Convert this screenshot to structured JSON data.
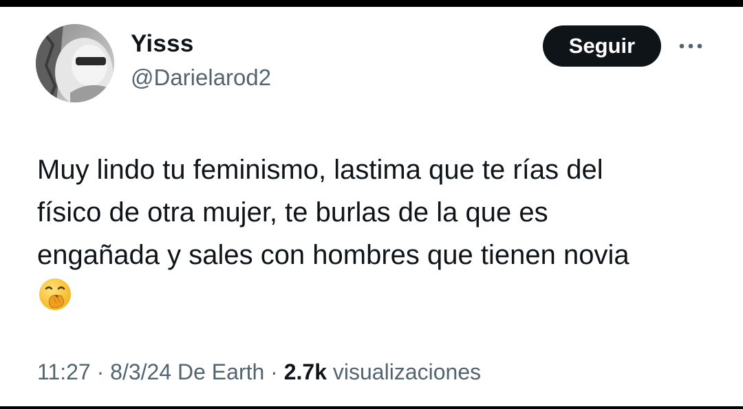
{
  "user": {
    "display_name": "Yisss",
    "handle": "@Darielarod2"
  },
  "actions": {
    "follow_label": "Seguir",
    "more_icon": "ellipsis-icon"
  },
  "tweet": {
    "lines": [
      "Muy lindo tu feminismo, lastima que te rías del",
      "físico de otra mujer, te burlas de la que es",
      "engañada y sales con hombres que tienen novia"
    ],
    "emoji": "yawning-face-emoji"
  },
  "meta": {
    "time": "11:27",
    "separator": "·",
    "date": "8/3/24",
    "source": "De Earth",
    "views_count": "2.7k",
    "views_label": "visualizaciones"
  },
  "colors": {
    "text_primary": "#0f1419",
    "text_secondary": "#536471",
    "button_bg": "#0f1419",
    "button_text": "#ffffff"
  }
}
